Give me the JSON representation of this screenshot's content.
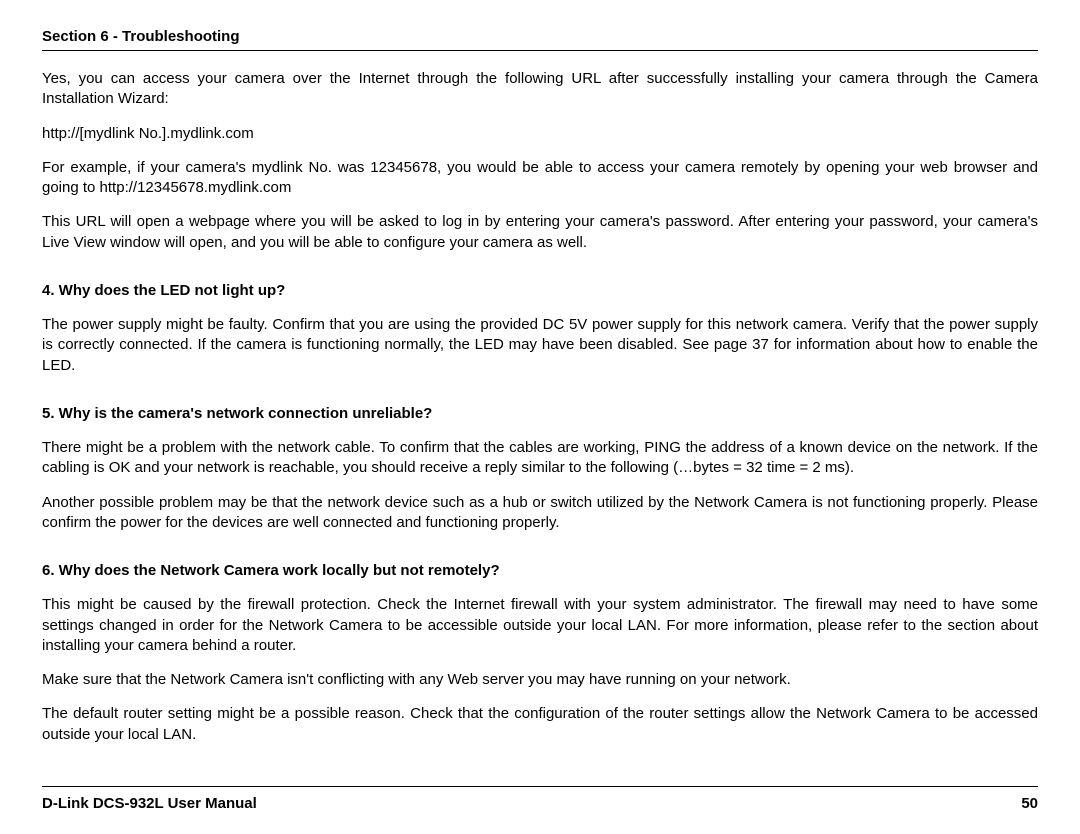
{
  "header": "Section 6 - Troubleshooting",
  "intro": {
    "p1": "Yes, you can access your camera over the Internet through the following URL after successfully installing your camera through the Camera Installation Wizard:",
    "p2": "http://[mydlink No.].mydlink.com",
    "p3": "For example, if your camera's mydlink No. was 12345678, you would be able to access your camera remotely by opening your web browser and going to http://12345678.mydlink.com",
    "p4": "This URL will open a webpage where you will be asked to log in by entering your camera's password. After entering your password, your camera's Live View window will open, and you will be able to configure your camera as well."
  },
  "q4": {
    "title": "4. Why does the LED not light up?",
    "p1": "The power supply might be faulty. Confirm that you are using the provided DC 5V power supply for this network camera. Verify that the power supply is correctly connected. If the camera is functioning normally, the LED may have been disabled. See page 37 for information about how to enable the LED."
  },
  "q5": {
    "title": "5. Why is the camera's network connection unreliable?",
    "p1": "There might be a problem with the network cable. To confirm that the cables are working, PING the address of a known device on the network. If the cabling is OK and your network is reachable, you should receive a reply similar to the following (…bytes = 32 time = 2 ms).",
    "p2": "Another possible problem may be that the network device such as a hub or switch utilized by the Network Camera is not functioning properly. Please confirm the power for the devices are well connected and functioning properly."
  },
  "q6": {
    "title": "6. Why does the Network Camera work locally but not remotely?",
    "p1": "This might be caused by the firewall protection. Check the Internet firewall with your system administrator. The firewall may need to have some settings changed in order for the Network Camera to be accessible outside your local LAN. For more information, please refer to the section about installing your camera behind a router.",
    "p2": "Make sure that the Network Camera isn't conflicting with any Web server you may have running on your network.",
    "p3": "The default router setting might be a possible reason. Check that the configuration of the router settings allow the Network Camera to be accessed outside your local LAN."
  },
  "footer": {
    "left": "D-Link DCS-932L User Manual",
    "right": "50"
  }
}
